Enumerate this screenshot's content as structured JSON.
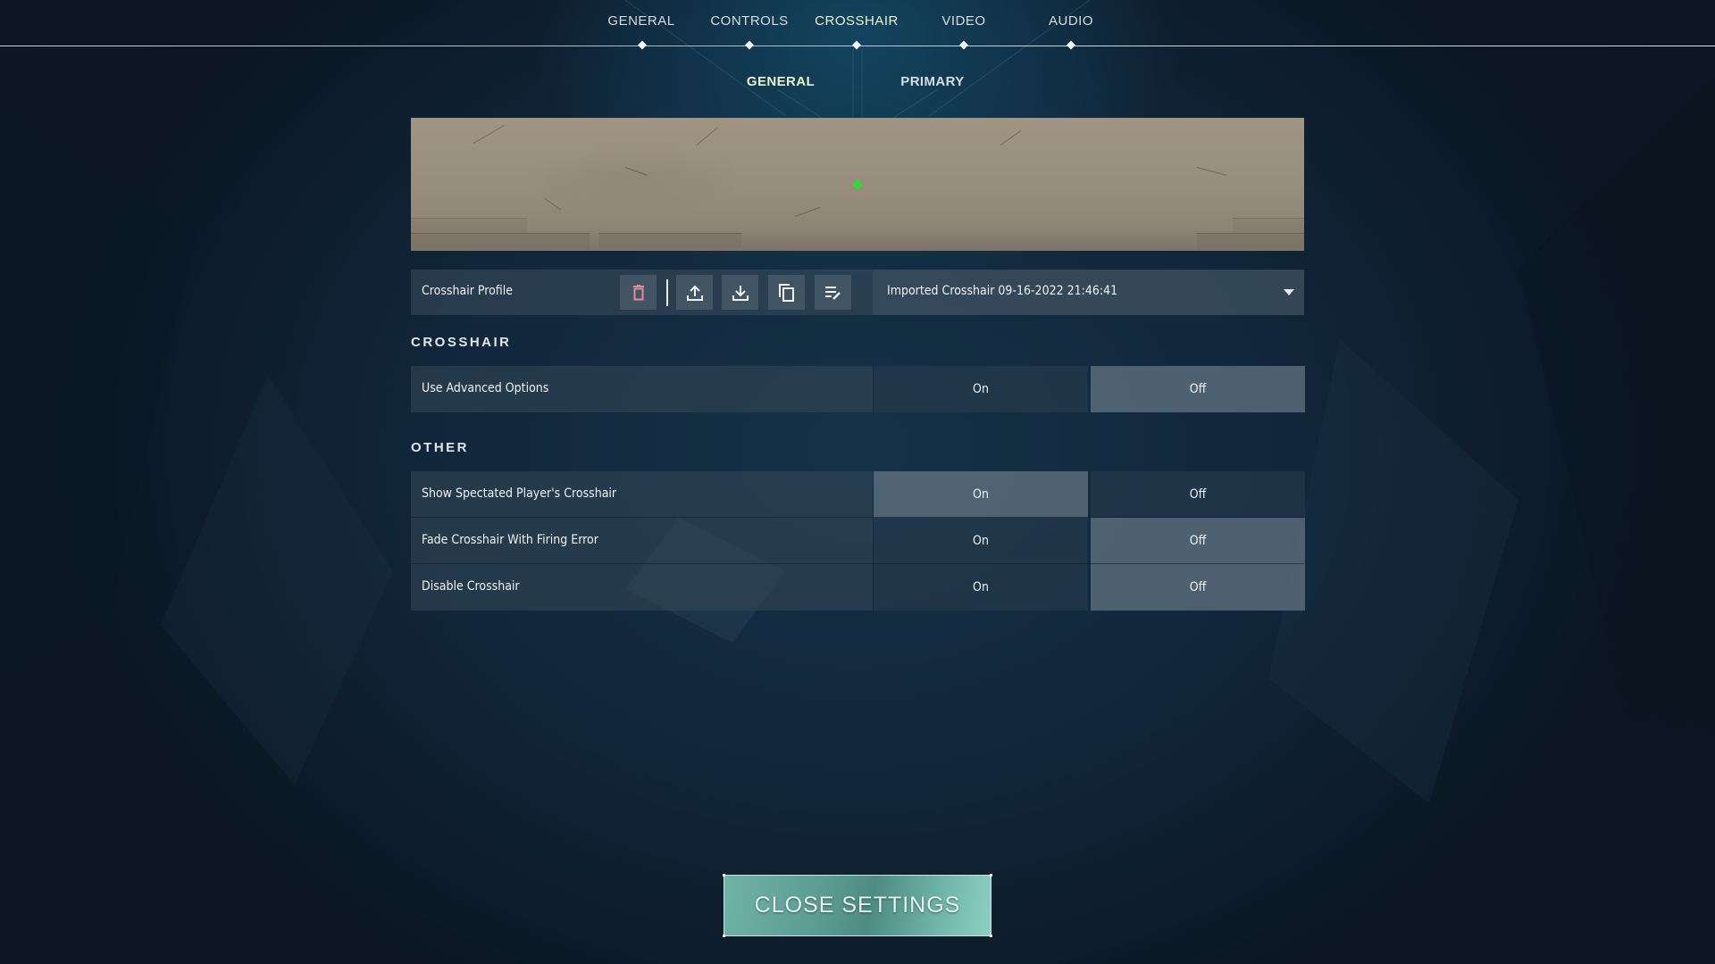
{
  "nav": {
    "tabs": [
      {
        "label": "GENERAL",
        "active": false
      },
      {
        "label": "CONTROLS",
        "active": false
      },
      {
        "label": "CROSSHAIR",
        "active": true
      },
      {
        "label": "VIDEO",
        "active": false
      },
      {
        "label": "AUDIO",
        "active": false
      }
    ],
    "subtabs": [
      {
        "label": "GENERAL",
        "active": true
      },
      {
        "label": "PRIMARY",
        "active": false
      }
    ]
  },
  "preview": {
    "crosshair_color": "#27e12a"
  },
  "profile": {
    "label": "Crosshair Profile",
    "actions": [
      {
        "name": "delete",
        "icon": "trash-icon",
        "color": "#e58a95"
      },
      {
        "name": "export",
        "icon": "upload-icon"
      },
      {
        "name": "import",
        "icon": "download-icon"
      },
      {
        "name": "copy",
        "icon": "copy-icon"
      },
      {
        "name": "rename",
        "icon": "edit-list-icon"
      }
    ],
    "selected": "Imported Crosshair 09-16-2022 21:46:41"
  },
  "sections": {
    "crosshair": {
      "title": "CROSSHAIR",
      "rows": [
        {
          "label": "Use Advanced Options",
          "on_label": "On",
          "off_label": "Off",
          "value": "Off"
        }
      ]
    },
    "other": {
      "title": "OTHER",
      "rows": [
        {
          "label": "Show Spectated Player's Crosshair",
          "on_label": "On",
          "off_label": "Off",
          "value": "On"
        },
        {
          "label": "Fade Crosshair With Firing Error",
          "on_label": "On",
          "off_label": "Off",
          "value": "Off"
        },
        {
          "label": "Disable Crosshair",
          "on_label": "On",
          "off_label": "Off",
          "value": "Off"
        }
      ]
    }
  },
  "footer": {
    "close_label": "CLOSE SETTINGS",
    "accent": "#6fb3a8"
  }
}
